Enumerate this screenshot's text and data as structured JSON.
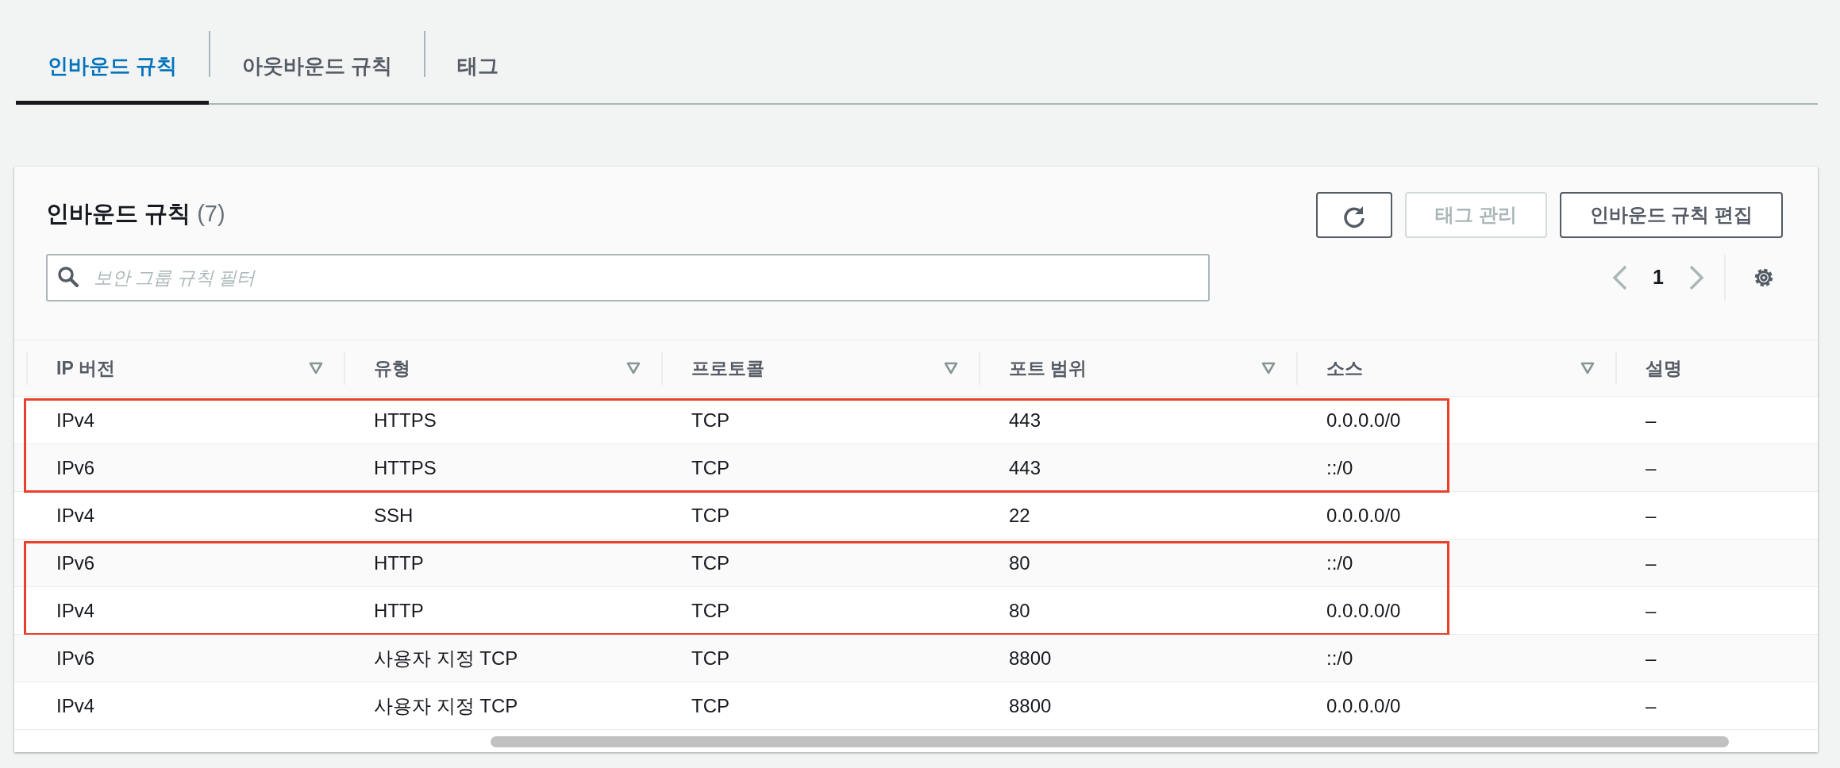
{
  "tabs": [
    {
      "label": "인바운드 규칙",
      "selected": true
    },
    {
      "label": "아웃바운드 규칙",
      "selected": false
    },
    {
      "label": "태그",
      "selected": false
    }
  ],
  "panel": {
    "title": "인바운드 규칙",
    "count": "(7)",
    "buttons": [
      {
        "kind": "refresh",
        "disabled": false
      },
      {
        "kind": "text",
        "label": "태그 관리",
        "disabled": true
      },
      {
        "kind": "text",
        "label": "인바운드 규칙 편집",
        "disabled": false
      }
    ],
    "search": {
      "placeholder": "보안 그룹 규칙 필터"
    },
    "pagination": {
      "prev_disabled": true,
      "page": "1",
      "next_disabled": true
    }
  },
  "table": {
    "columns": [
      {
        "label": "IP 버전",
        "sortable": true
      },
      {
        "label": "유형",
        "sortable": true
      },
      {
        "label": "프로토콜",
        "sortable": true
      },
      {
        "label": "포트 범위",
        "sortable": true
      },
      {
        "label": "소스",
        "sortable": true
      },
      {
        "label": "설명",
        "sortable": false
      }
    ],
    "row_groups": [
      {
        "highlighted": true,
        "rows": [
          [
            "IPv4",
            "HTTPS",
            "TCP",
            "443",
            "0.0.0.0/0",
            "–"
          ],
          [
            "IPv6",
            "HTTPS",
            "TCP",
            "443",
            "::/0",
            "–"
          ]
        ]
      },
      {
        "highlighted": false,
        "rows": [
          [
            "IPv4",
            "SSH",
            "TCP",
            "22",
            "0.0.0.0/0",
            "–"
          ]
        ]
      },
      {
        "highlighted": true,
        "rows": [
          [
            "IPv6",
            "HTTP",
            "TCP",
            "80",
            "::/0",
            "–"
          ],
          [
            "IPv4",
            "HTTP",
            "TCP",
            "80",
            "0.0.0.0/0",
            "–"
          ]
        ]
      },
      {
        "highlighted": false,
        "rows": [
          [
            "IPv6",
            "사용자 지정 TCP",
            "TCP",
            "8800",
            "::/0",
            "–"
          ],
          [
            "IPv4",
            "사용자 지정 TCP",
            "TCP",
            "8800",
            "0.0.0.0/0",
            "–"
          ]
        ]
      }
    ]
  }
}
